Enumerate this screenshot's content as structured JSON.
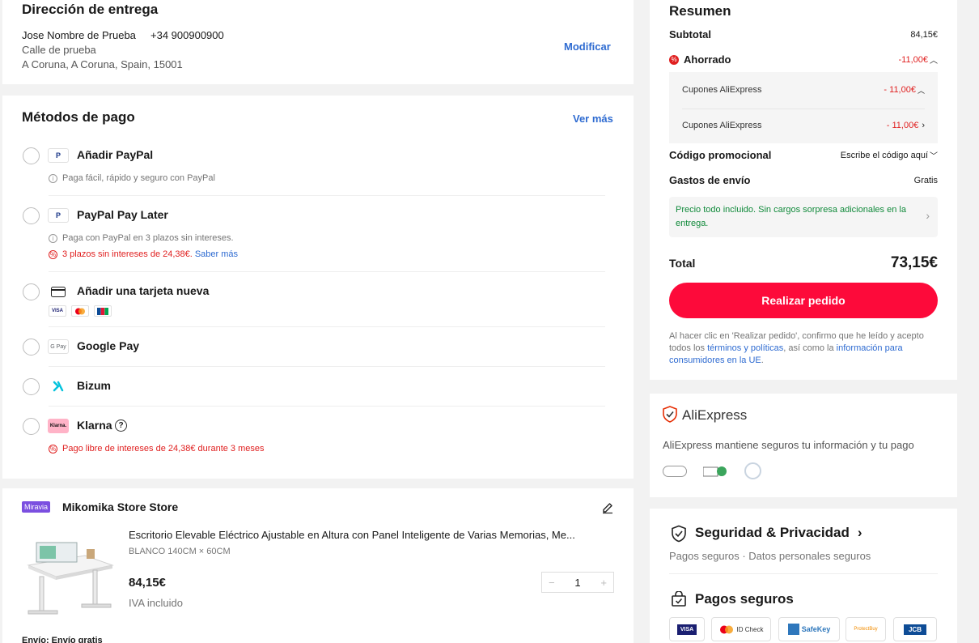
{
  "address": {
    "title": "Dirección de entrega",
    "name": "Jose Nombre de Prueba",
    "phone": "+34 900900900",
    "street": "Calle de prueba",
    "city": "A Coruna, A Coruna, Spain, 15001",
    "modify_label": "Modificar"
  },
  "payment": {
    "title": "Métodos de pago",
    "more_label": "Ver más",
    "methods": [
      {
        "label": "Añadir PayPal",
        "sub": "Paga fácil, rápido y seguro con PayPal"
      },
      {
        "label": "PayPal Pay Later",
        "sub": "Paga con PayPal en 3 plazos sin intereses.",
        "promo": "3 plazos sin intereses de 24,38€.",
        "promo_link": "Saber más"
      },
      {
        "label": "Añadir una tarjeta nueva",
        "cards": [
          "VISA",
          "MC",
          "JCB"
        ]
      },
      {
        "label": "Google Pay",
        "icon_text": "G Pay"
      },
      {
        "label": "Bizum"
      },
      {
        "label": "Klarna",
        "icon_text": "Klarna.",
        "promo": "Pago libre de intereses de 24,38€ durante 3 meses"
      }
    ]
  },
  "store": {
    "badge": "Miravia",
    "name": "Mikomika Store Store",
    "product_title": "Escritorio Elevable Eléctrico Ajustable en Altura con Panel Inteligente de Varias Memorias, Me...",
    "variant": "BLANCO 140CM × 60CM",
    "price": "84,15€",
    "vat": "IVA incluido",
    "quantity": "1",
    "minus": "−",
    "plus": "+",
    "shipping": "Envío: Envío gratis"
  },
  "summary": {
    "title": "Resumen",
    "subtotal_label": "Subtotal",
    "subtotal_value": "84,15€",
    "saved_label": "Ahorrado",
    "saved_value": "-11,00€",
    "coupons": [
      {
        "label": "Cupones AliExpress",
        "value": "- 11,00€"
      },
      {
        "label": "Cupones AliExpress",
        "value": "- 11,00€"
      }
    ],
    "promo_label": "Código promocional",
    "promo_placeholder": "Escribe el código aquí",
    "shipping_label": "Gastos de envío",
    "shipping_value": "Gratis",
    "notice": "Precio todo incluido. Sin cargos sorpresa adicionales en la entrega.",
    "total_label": "Total",
    "total_value": "73,15€",
    "order_button": "Realizar pedido",
    "legal_1": "Al hacer clic en 'Realizar pedido', confirmo que he leído y acepto todos los ",
    "legal_link1": "términos y políticas",
    "legal_2": ", así como la ",
    "legal_link2": "información para consumidores en la UE",
    "legal_3": "."
  },
  "trust": {
    "brand": "AliExpress",
    "text": "AliExpress mantiene seguros tu información y tu pago"
  },
  "security": {
    "title": "Seguridad & Privacidad",
    "sub": "Pagos seguros · Datos personales seguros",
    "payments_title": "Pagos seguros",
    "logos": [
      "VISA",
      "ID Check",
      "SafeKey",
      "ProtectBuy",
      "JCB"
    ]
  },
  "colors": {
    "accent": "#fd0a3a",
    "link": "#2e6bd1",
    "promo_red": "#e02020",
    "notice_green": "#118a3b"
  }
}
